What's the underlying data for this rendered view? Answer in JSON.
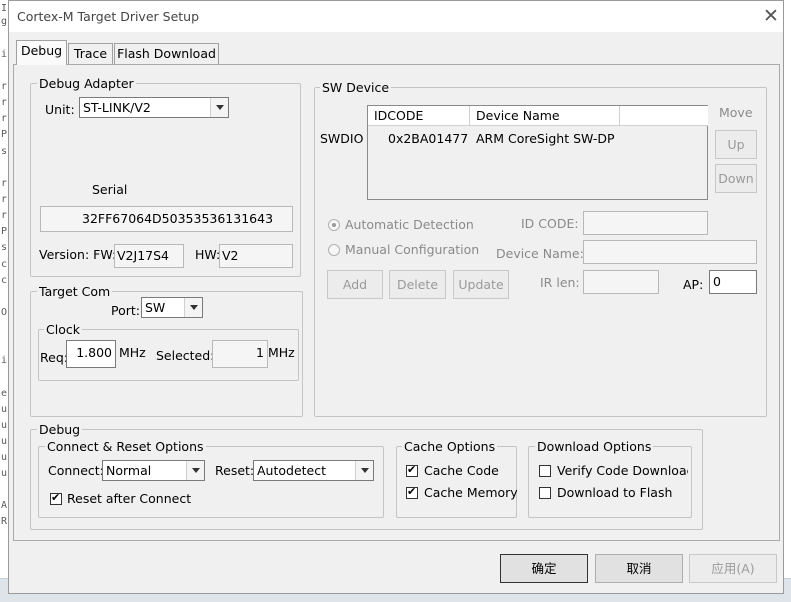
{
  "background_editor": {
    "lines": [
      "I",
      "g",
      "i",
      "r",
      "r",
      "r",
      "P",
      "s",
      "r",
      "r",
      "r",
      "P",
      "s",
      "c",
      "c",
      "O",
      "i",
      "e",
      "u",
      "u",
      "u",
      "u",
      "u",
      "A",
      "R"
    ]
  },
  "window": {
    "title": "Cortex-M Target Driver Setup",
    "close_glyph": "✕"
  },
  "tabs": [
    {
      "label": "Debug",
      "active": true
    },
    {
      "label": "Trace",
      "active": false
    },
    {
      "label": "Flash Download",
      "active": false
    }
  ],
  "debug_adapter": {
    "group_label": "Debug Adapter",
    "unit_label": "Unit:",
    "unit_value": "ST-LINK/V2",
    "serial_label": "Serial",
    "serial_value": "32FF67064D50353536131643",
    "version_label": "Version: FW:",
    "fw_value": "V2J17S4",
    "hw_label": "HW:",
    "hw_value": "V2"
  },
  "target_com": {
    "group_label": "Target Com",
    "port_label": "Port:",
    "port_value": "SW",
    "clock": {
      "group_label": "Clock",
      "req_label": "Req:",
      "req_value": "1.800",
      "req_unit": "MHz",
      "selected_label": "Selected:",
      "selected_value": "1",
      "selected_unit": "MHz"
    }
  },
  "sw_device": {
    "group_label": "SW Device",
    "columns": [
      "IDCODE",
      "Device Name"
    ],
    "rows": [
      {
        "port": "SWDIO",
        "idcode": "0x2BA01477",
        "device_name": "ARM CoreSight SW-DP"
      }
    ],
    "move_label": "Move",
    "up_button": "Up",
    "down_button": "Down",
    "auto_detection_label": "Automatic Detection",
    "manual_config_label": "Manual Configuration",
    "id_code_label": "ID CODE:",
    "id_code_value": "",
    "device_name_label": "Device Name:",
    "device_name_value": "",
    "add_button": "Add",
    "delete_button": "Delete",
    "update_button": "Update",
    "ir_len_label": "IR len:",
    "ir_len_value": "",
    "ap_label": "AP:",
    "ap_value": "0"
  },
  "debug": {
    "group_label": "Debug",
    "connect_reset": {
      "group_label": "Connect & Reset Options",
      "connect_label": "Connect:",
      "connect_value": "Normal",
      "reset_label": "Reset:",
      "reset_value": "Autodetect",
      "reset_after_connect_label": "Reset after Connect",
      "reset_after_connect_checked": true
    },
    "cache_options": {
      "group_label": "Cache Options",
      "cache_code_label": "Cache Code",
      "cache_code_checked": true,
      "cache_memory_label": "Cache Memory",
      "cache_memory_checked": true
    },
    "download_options": {
      "group_label": "Download Options",
      "verify_label": "Verify Code Downloac",
      "verify_checked": false,
      "download_flash_label": "Download to Flash",
      "download_flash_checked": false
    }
  },
  "footer": {
    "ok_button": "确定",
    "cancel_button": "取消",
    "apply_button": "应用(A)"
  }
}
